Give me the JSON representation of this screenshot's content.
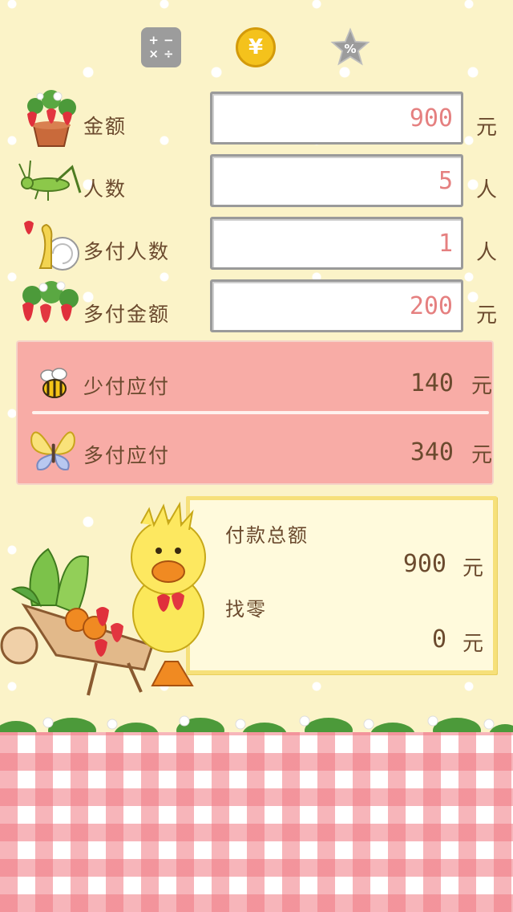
{
  "modes": {
    "calc_icon": "calculator-icon",
    "yen_symbol": "¥",
    "percent_symbol": "%"
  },
  "inputs": [
    {
      "label": "金额",
      "value": "900",
      "unit": "元",
      "icon": "strawberry-pot-icon"
    },
    {
      "label": "人数",
      "value": "5",
      "unit": "人",
      "icon": "grasshopper-icon"
    },
    {
      "label": "多付人数",
      "value": "1",
      "unit": "人",
      "icon": "snail-icon"
    },
    {
      "label": "多付金额",
      "value": "200",
      "unit": "元",
      "icon": "strawberries-icon"
    }
  ],
  "results": [
    {
      "label": "少付应付",
      "value": "140",
      "unit": "元",
      "icon": "bee-icon"
    },
    {
      "label": "多付应付",
      "value": "340",
      "unit": "元",
      "icon": "butterfly-icon"
    }
  ],
  "payment": {
    "total_label": "付款总额",
    "total_value": "900",
    "total_unit": "元",
    "change_label": "找零",
    "change_value": "0",
    "change_unit": "元"
  },
  "colors": {
    "background": "#fbf3c8",
    "value_text": "#e58080",
    "label_text": "#6b4a2e",
    "result_panel": "#f8aca6",
    "card_border": "#f6e07a"
  }
}
